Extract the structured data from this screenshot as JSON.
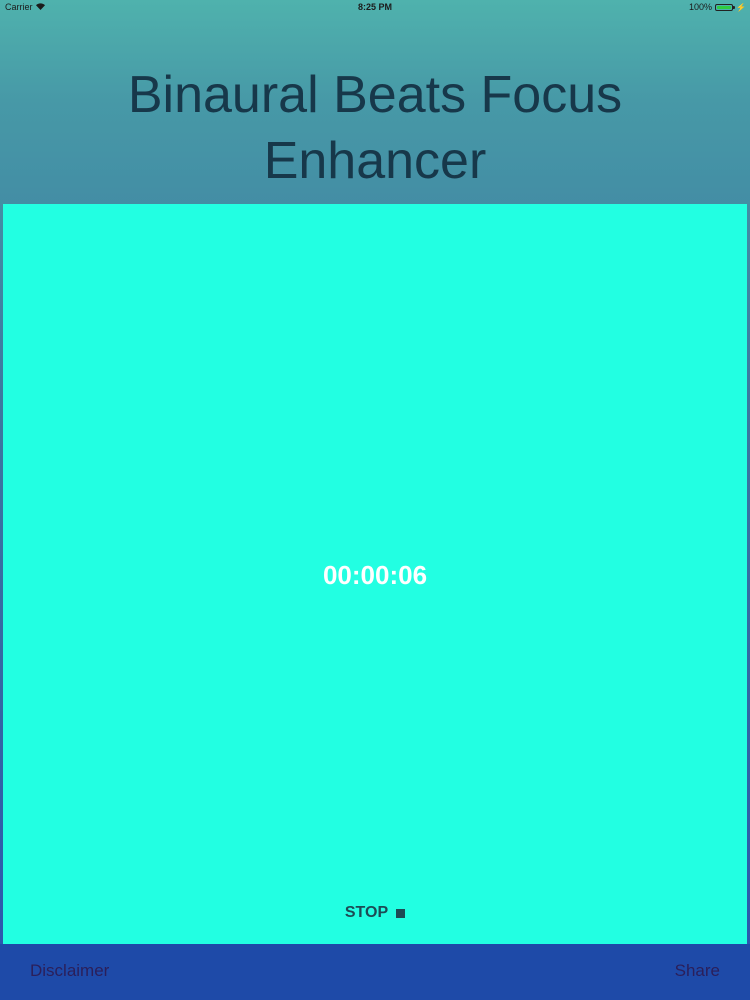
{
  "status_bar": {
    "carrier": "Carrier",
    "wifi_icon": "wifi-icon",
    "time": "8:25 PM",
    "battery_percent": "100%",
    "battery_level": 1.0,
    "battery_color": "#2ecc40"
  },
  "app": {
    "title_line1": "Binaural Beats Focus",
    "title_line2": "Enhancer"
  },
  "player": {
    "background_color": "#22ffe2",
    "timer": "00:00:06",
    "stop_label": "STOP",
    "stop_icon": "stop-square-icon"
  },
  "bottom_bar": {
    "disclaimer_label": "Disclaimer",
    "share_label": "Share"
  }
}
